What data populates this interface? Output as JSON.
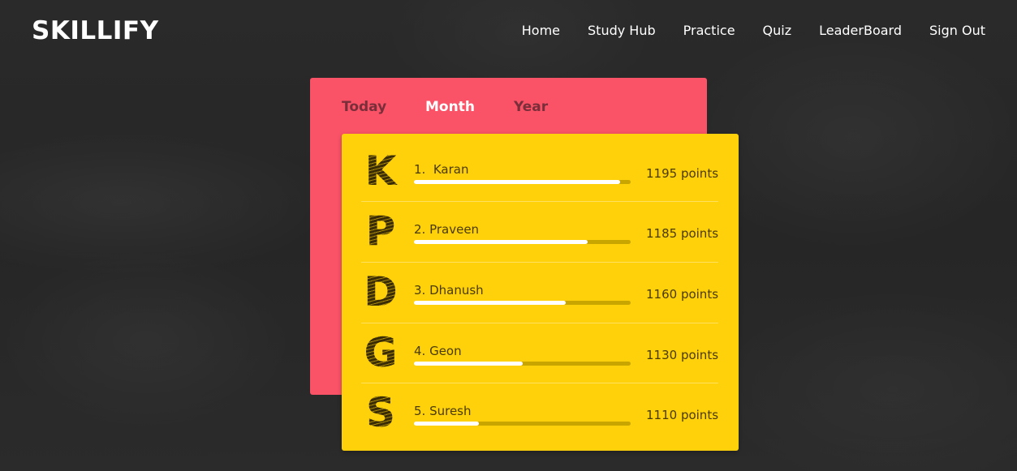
{
  "header": {
    "brand": "SKILLIFY",
    "nav": [
      "Home",
      "Study Hub",
      "Practice",
      "Quiz",
      "LeaderBoard",
      "Sign Out"
    ]
  },
  "leaderboard": {
    "tabs": [
      "Today",
      "Month",
      "Year"
    ],
    "active_tab": "Month",
    "entries": [
      {
        "initial": "K",
        "label": "1.  Karan",
        "points": "1195 points",
        "progress": 0.95
      },
      {
        "initial": "P",
        "label": "2. Praveen",
        "points": "1185 points",
        "progress": 0.8
      },
      {
        "initial": "D",
        "label": "3. Dhanush",
        "points": "1160 points",
        "progress": 0.7
      },
      {
        "initial": "G",
        "label": "4. Geon",
        "points": "1130 points",
        "progress": 0.5
      },
      {
        "initial": "S",
        "label": "5. Suresh",
        "points": "1110 points",
        "progress": 0.3
      }
    ]
  },
  "colors": {
    "background": "#272727",
    "back_card": "#fa5368",
    "front_card": "#ffd10a",
    "bar_track": "#c9a500",
    "bar_fill": "#ffffff"
  }
}
